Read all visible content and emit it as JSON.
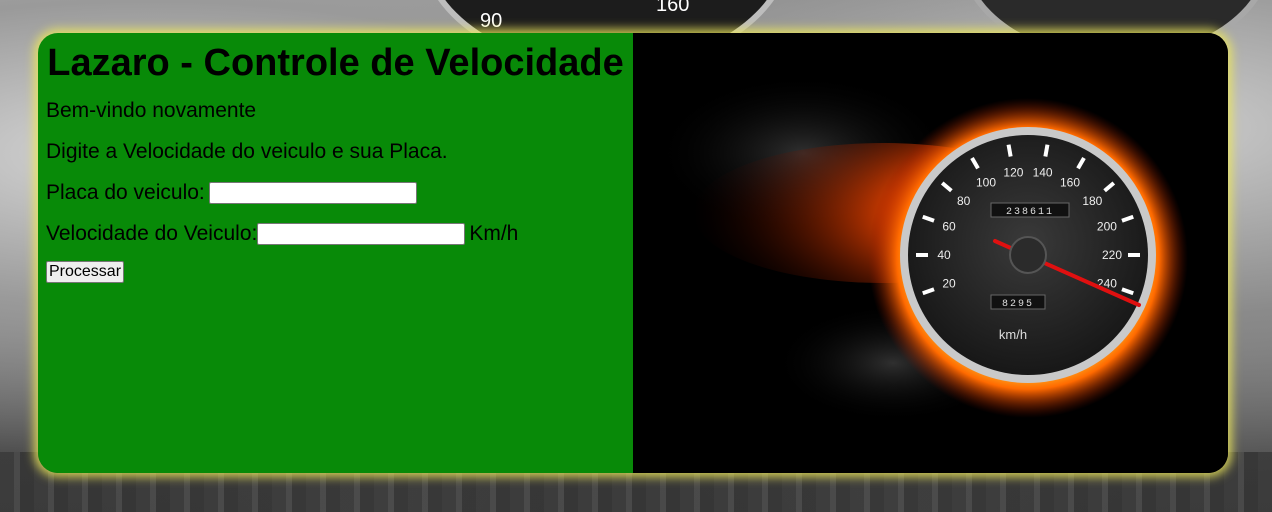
{
  "background": {
    "gauge_numbers": [
      "90",
      "160"
    ]
  },
  "form": {
    "title": "Lazaro - Controle de Velocidade",
    "welcome": "Bem-vindo novamente",
    "instruction": "Digite a Velocidade do veiculo e sua Placa.",
    "plate_label": "Placa do veiculo:",
    "plate_value": "",
    "speed_label": "Velocidade do Veiculo:",
    "speed_value": "",
    "speed_unit": "Km/h",
    "submit_label": "Processar"
  },
  "speedometer": {
    "tick_labels": [
      "20",
      "40",
      "60",
      "80",
      "100",
      "120",
      "140",
      "160",
      "180",
      "200",
      "220",
      "240"
    ],
    "odometer_top": "238611",
    "odometer_bottom": "8295",
    "unit": "km/h",
    "needle_value": 235,
    "colors": {
      "flame_outer": "#ff3a00",
      "flame_inner": "#ffcc33",
      "dial": "#2a2a2a",
      "needle": "#e01010"
    }
  }
}
